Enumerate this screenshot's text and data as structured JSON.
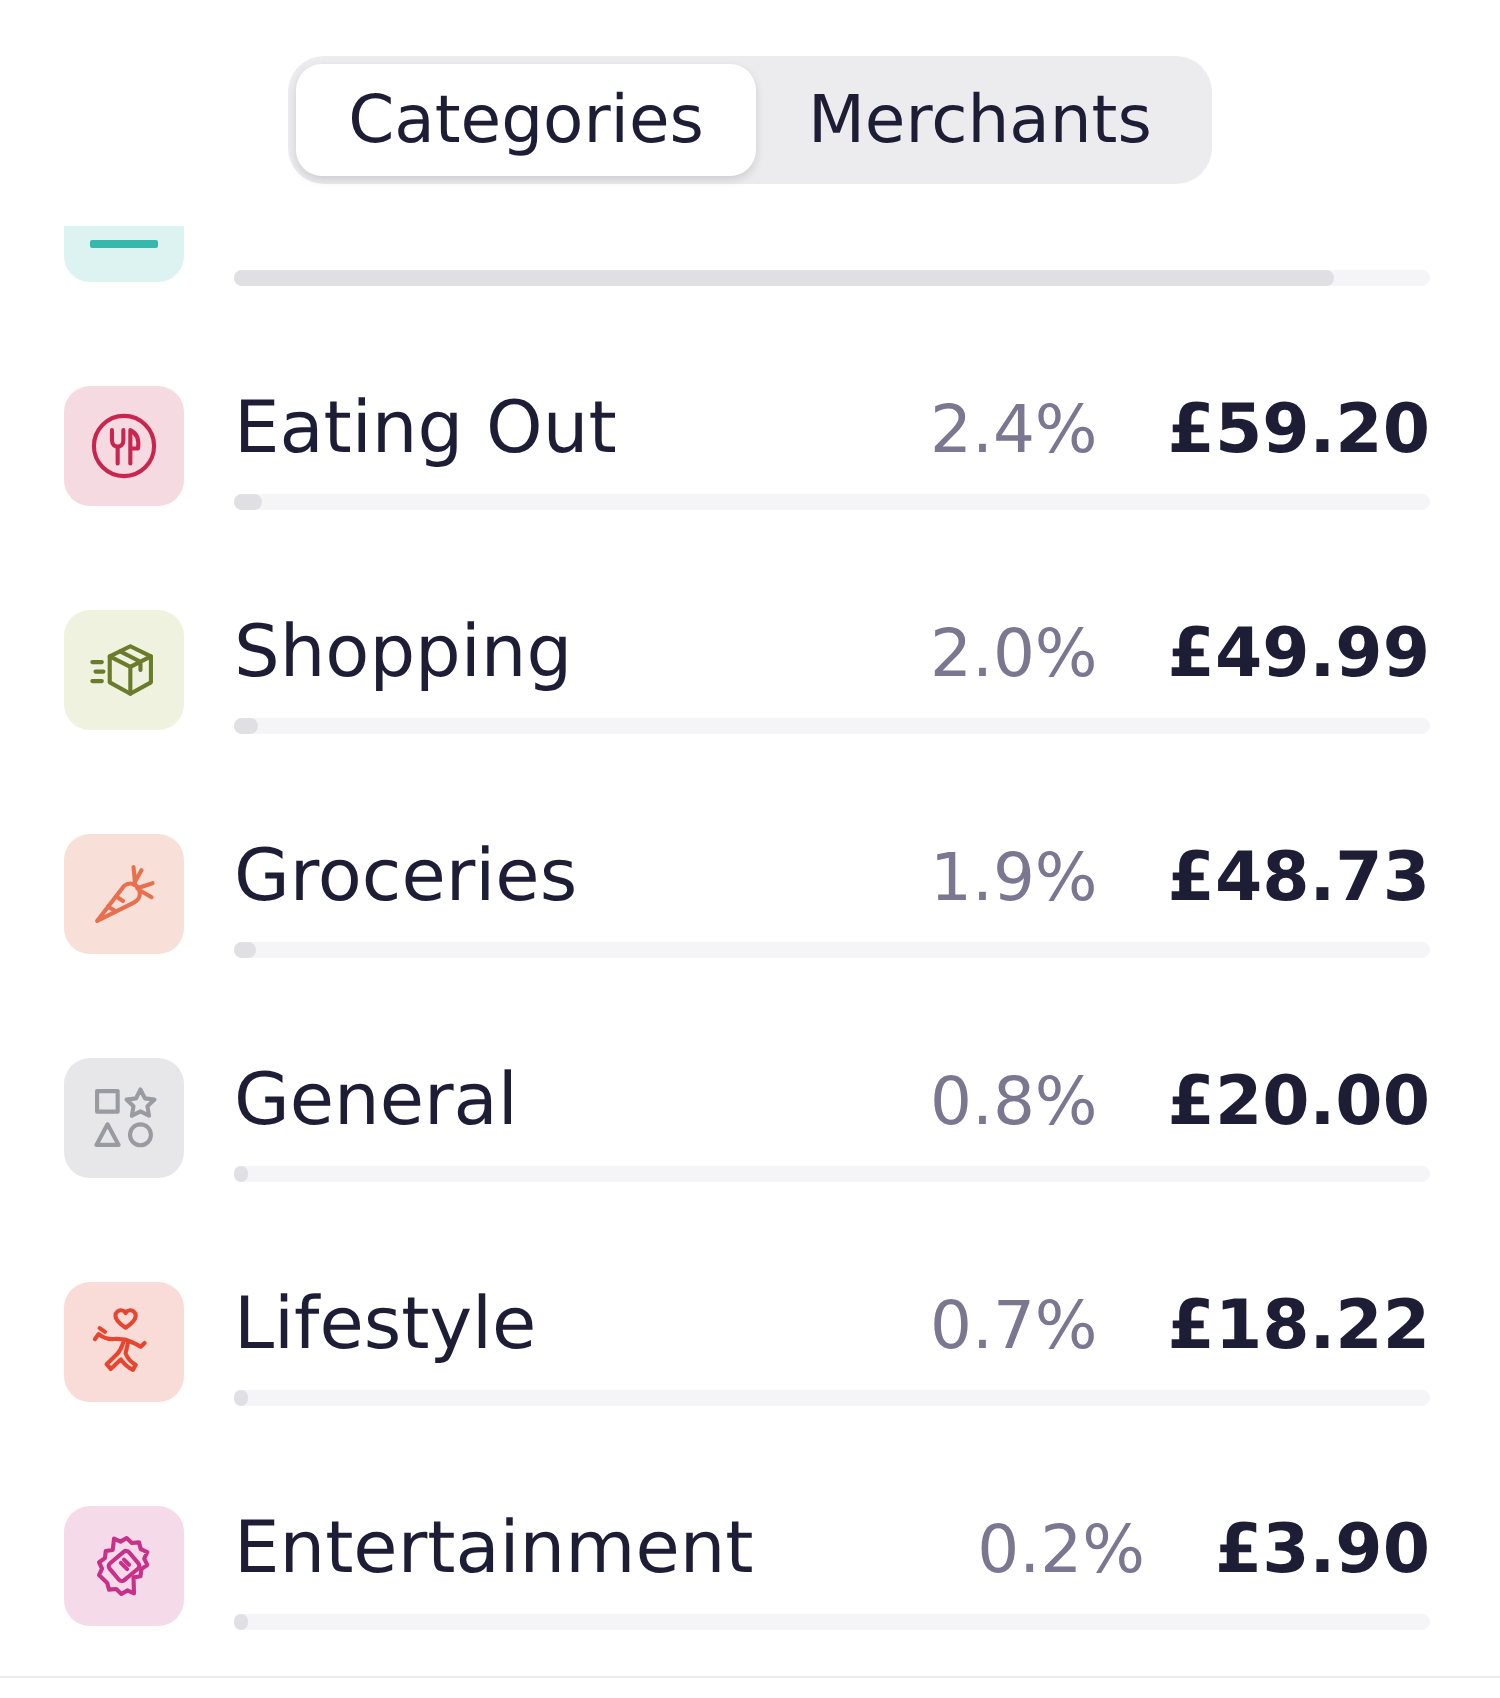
{
  "segmented_control": {
    "tabs": [
      {
        "label": "Categories",
        "selected": true
      },
      {
        "label": "Merchants",
        "selected": false
      }
    ]
  },
  "categories": [
    {
      "kind": "partial",
      "color": "#36b9ac",
      "level": 0.92
    },
    {
      "kind": "full",
      "name": "Eating Out",
      "percent": "2.4%",
      "amount": "£59.20",
      "color": "#c8254f",
      "level": 0.024
    },
    {
      "kind": "full",
      "name": "Shopping",
      "percent": "2.0%",
      "amount": "£49.99",
      "color": "#6b7b2c",
      "level": 0.02
    },
    {
      "kind": "full",
      "name": "Groceries",
      "percent": "1.9%",
      "amount": "£48.73",
      "color": "#e8704f",
      "level": 0.019
    },
    {
      "kind": "full",
      "name": "General",
      "percent": "0.8%",
      "amount": "£20.00",
      "color": "#9a9aa1",
      "level": 0.008
    },
    {
      "kind": "full",
      "name": "Lifestyle",
      "percent": "0.7%",
      "amount": "£18.22",
      "color": "#e8452f",
      "level": 0.007
    },
    {
      "kind": "full",
      "name": "Entertainment",
      "percent": "0.2%",
      "amount": "£3.90",
      "color": "#c8308a",
      "level": 0.002
    }
  ]
}
